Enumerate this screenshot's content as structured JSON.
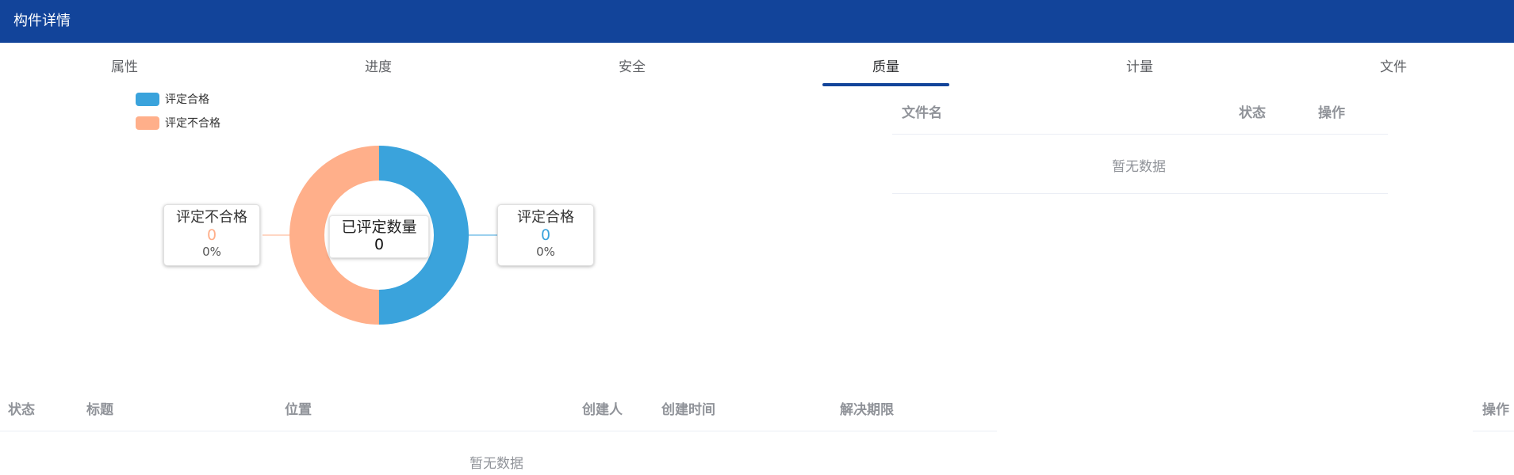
{
  "header": {
    "title": "构件详情"
  },
  "tabs": [
    {
      "label": "属性",
      "active": false
    },
    {
      "label": "进度",
      "active": false
    },
    {
      "label": "安全",
      "active": false
    },
    {
      "label": "质量",
      "active": true
    },
    {
      "label": "计量",
      "active": false
    },
    {
      "label": "文件",
      "active": false
    }
  ],
  "colors": {
    "header": "#12449a",
    "qualified": "#3aa3dc",
    "unqualified": "#ffaf8a"
  },
  "chart_data": {
    "type": "pie",
    "legend": [
      "评定合格",
      "评定不合格"
    ],
    "center_label": "已评定数量",
    "center_value": "0",
    "slices": [
      {
        "name": "评定合格",
        "value": 0,
        "percent": "0%",
        "display_share": 0.5
      },
      {
        "name": "评定不合格",
        "value": 0,
        "percent": "0%",
        "display_share": 0.5
      }
    ]
  },
  "callouts": {
    "unqualified": {
      "title": "评定不合格",
      "value": "0",
      "percent": "0%"
    },
    "qualified": {
      "title": "评定合格",
      "value": "0",
      "percent": "0%"
    }
  },
  "file_table": {
    "columns": [
      "文件名",
      "状态",
      "操作"
    ],
    "empty_text": "暂无数据"
  },
  "issue_table": {
    "columns": [
      "状态",
      "标题",
      "位置",
      "创建人",
      "创建时间",
      "解决期限",
      "操作"
    ],
    "empty_text": "暂无数据"
  }
}
